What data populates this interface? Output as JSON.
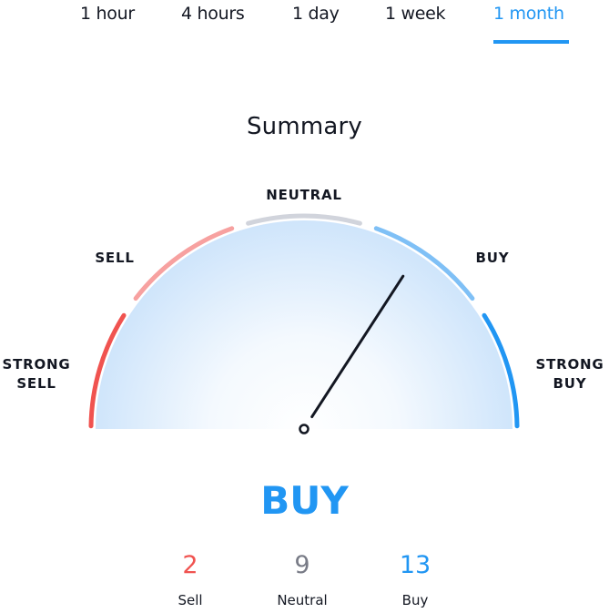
{
  "tabs": [
    {
      "label": "1 hour",
      "active": false
    },
    {
      "label": "4 hours",
      "active": false
    },
    {
      "label": "1 day",
      "active": false
    },
    {
      "label": "1 week",
      "active": false
    },
    {
      "label": "1 month",
      "active": true
    }
  ],
  "title": "Summary",
  "gauge": {
    "labels": {
      "strong_sell": [
        "STRONG",
        "SELL"
      ],
      "sell": "SELL",
      "neutral": "NEUTRAL",
      "buy": "BUY",
      "strong_buy": [
        "STRONG",
        "BUY"
      ]
    },
    "segment_colors": {
      "strong_sell": "#f05350",
      "sell": "#f7a1a0",
      "neutral": "#d1d4dc",
      "buy": "#7fc0f6",
      "strong_buy": "#2196f3"
    },
    "needle_value_fraction": 0.683
  },
  "verdict": "BUY",
  "counts": [
    {
      "value": "2",
      "label": "Sell",
      "color": "#f05350"
    },
    {
      "value": "9",
      "label": "Neutral",
      "color": "#787b86"
    },
    {
      "value": "13",
      "label": "Buy",
      "color": "#2196f3"
    }
  ]
}
